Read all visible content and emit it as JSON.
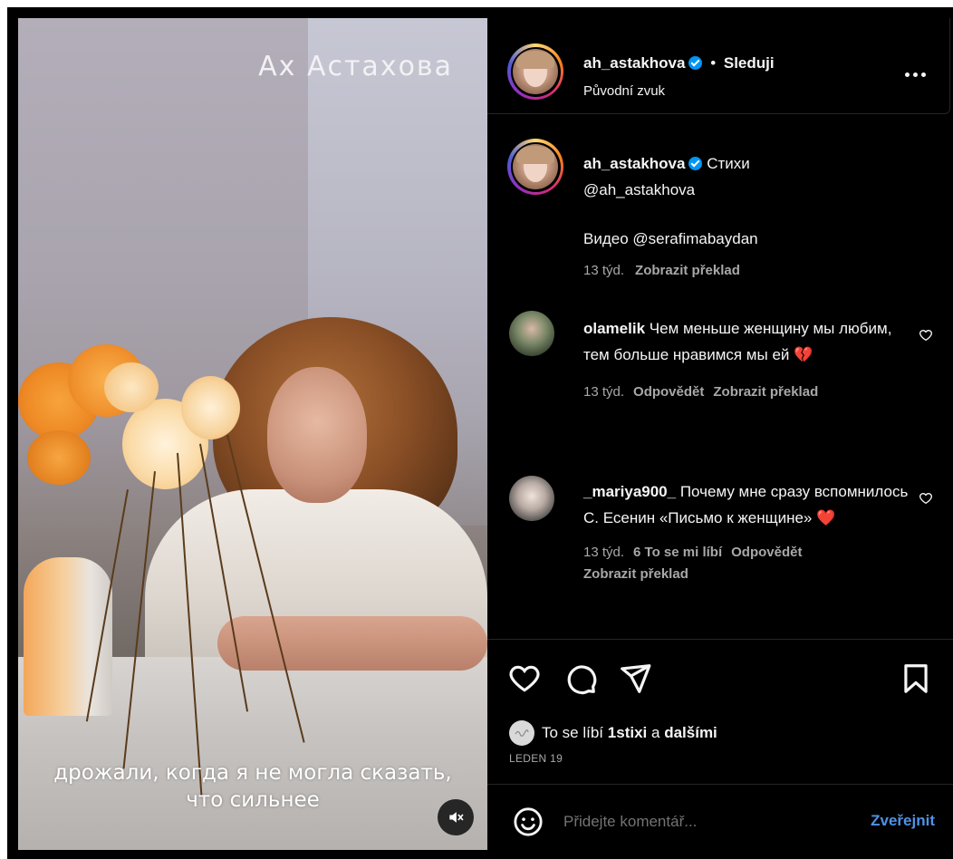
{
  "video": {
    "overlay_title": "Ах Астахова",
    "subtitle_line1": "дрожали, когда я не могла сказать,",
    "subtitle_line2": "что сильнее"
  },
  "header": {
    "username": "ah_astakhova",
    "separator": "•",
    "follow_state": "Sleduji",
    "audio": "Původní zvuk"
  },
  "caption": {
    "username": "ah_astakhova",
    "text_line1": "Стихи",
    "text_line2": "@ah_astakhova",
    "text_line3": "Видео @serafimabaydan",
    "age": "13 týd.",
    "translate": "Zobrazit překlad"
  },
  "comments": [
    {
      "username": "olamelik",
      "text": "Чем меньше женщину мы любим, тем больше нравимся мы ей 💔",
      "age": "13 týd.",
      "reply": "Odpovědět",
      "translate": "Zobrazit překlad"
    },
    {
      "username": "_mariya900_",
      "text": "Почему мне сразу вспомнилось С. Есенин «Письмо к женщине» ❤️",
      "age": "13 týd.",
      "likes": "6 To se mi líbí",
      "reply": "Odpovědět",
      "translate": "Zobrazit překlad"
    }
  ],
  "likes": {
    "prefix": "To se líbí",
    "user": "1stixi",
    "joiner": "a",
    "others": "dalšími",
    "date": "LEDEN 19"
  },
  "composer": {
    "placeholder": "Přidejte komentář...",
    "post_label": "Zveřejnit"
  },
  "colors": {
    "background": "#000000",
    "accent_blue": "#0095f6",
    "post_link": "#4f93e6",
    "muted_text": "#a8a8a8",
    "broken_heart": "#e0245e"
  },
  "icons": [
    "heart-icon",
    "comment-icon",
    "share-icon",
    "bookmark-icon",
    "more-icon",
    "verified-icon",
    "mute-icon",
    "emoji-icon"
  ]
}
